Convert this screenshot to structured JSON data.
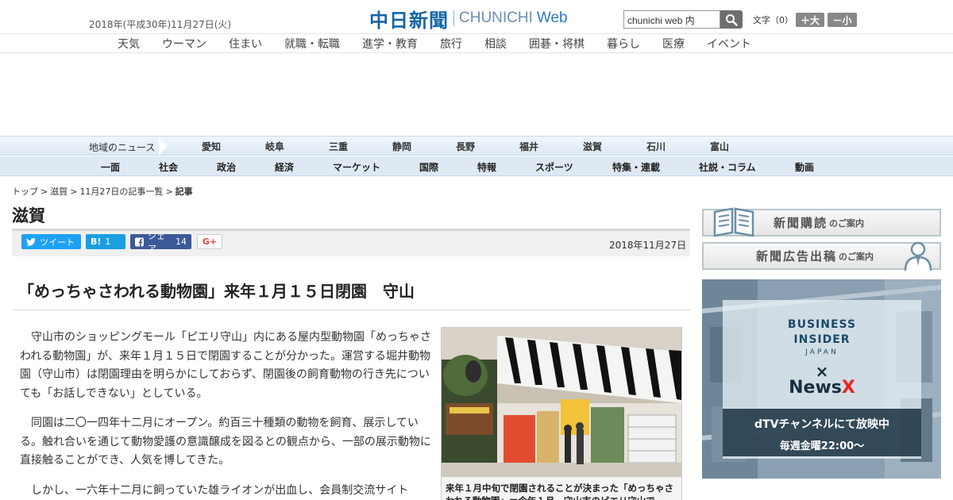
{
  "header": {
    "date": "2018年(平成30年)11月27日(火)",
    "logo_main": "中日新聞",
    "logo_sub": "CHUNICHI",
    "logo_web": "Web",
    "search_value": "chunichi web 内",
    "text_size_label": "文字（0）",
    "text_size_larger": "＋大",
    "text_size_smaller": "－小"
  },
  "category_nav": [
    "天気",
    "ウーマン",
    "住まい",
    "就職・転職",
    "進学・教育",
    "旅行",
    "相談",
    "囲碁・将棋",
    "暮らし",
    "医療",
    "イベント"
  ],
  "region_nav": {
    "label": "地域のニュース",
    "items": [
      "愛知",
      "岐阜",
      "三重",
      "静岡",
      "長野",
      "福井",
      "滋賀",
      "石川",
      "富山"
    ]
  },
  "section_nav": [
    "一面",
    "社会",
    "政治",
    "経済",
    "マーケット",
    "国際",
    "特報",
    "スポーツ",
    "特集・連載",
    "社説・コラム",
    "動画"
  ],
  "breadcrumb": [
    "トップ",
    "滋賀",
    "11月27日の記事一覧",
    "記事"
  ],
  "section_title": "滋賀",
  "share": {
    "tweet": "ツイート",
    "hatena": "B!",
    "hatena_count": "1",
    "facebook": "シェア",
    "facebook_count": "14",
    "gplus": "G+"
  },
  "article": {
    "date": "2018年11月27日",
    "headline": "「めっちゃさわれる動物園」来年１月１５日閉園　守山",
    "paragraphs": [
      "守山市のショッピングモール「ピエリ守山」内にある屋内型動物園「めっちゃさわれる動物園」が、来年１月１５日で閉園することが分かった。運営する堀井動物園（守山市）は閉園理由を明らかにしておらず、閉園後の飼育動物の行き先についても「お話しできない」としている。",
      "同園は二〇一四年十二月にオープン。約百三十種類の動物を飼育、展示している。触れ合いを通じて動物愛護の意識醸成を図るとの観点から、一部の展示動物に直接触ることができ、人気を博してきた。",
      "しかし、一六年十二月に飼っていた雄ライオンが出血し、会員制交流サイト"
    ],
    "photo_caption": "来年１月中旬で閉園されることが決まった「めっちゃさわれる動物園」＝今年１月、守山市のピエリ守山で"
  },
  "sidebar": {
    "subscribe_main": "新聞購読",
    "subscribe_sub": "のご案内",
    "ad_main": "新聞広告出稿",
    "ad_sub": "のご案内",
    "banner": {
      "line1": "BUSINESS",
      "line2": "INSIDER",
      "line3": "JAPAN",
      "cross": "×",
      "newsx_a": "News",
      "newsx_b": "X",
      "schedule1": "dTVチャンネルにて放映中",
      "schedule2": "毎週金曜22:00〜"
    }
  },
  "colors": {
    "brand_blue": "#1565a8",
    "twitter": "#1da1f2",
    "hatena": "#1a9fe0",
    "facebook": "#3b5998"
  }
}
